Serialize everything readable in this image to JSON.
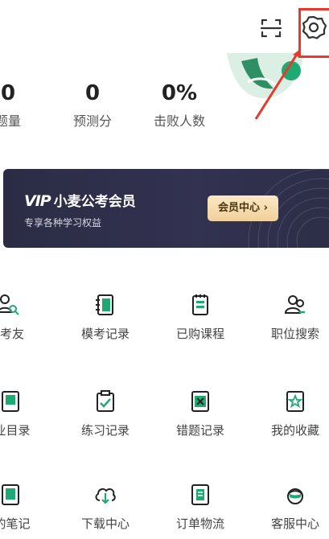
{
  "header": {
    "scan_icon": "scan-icon",
    "settings_icon": "gear-icon",
    "highlight_color": "#e8392b"
  },
  "stats": [
    {
      "value": "0",
      "label": "题量"
    },
    {
      "value": "0",
      "label": "预测分"
    },
    {
      "value": "0%",
      "label": "击败人数"
    }
  ],
  "vip": {
    "logo": "VIP",
    "title": "小麦公考会员",
    "subtitle": "专享各种学习权益",
    "button_label": "会员中心",
    "button_chevron": "›"
  },
  "menu": {
    "row1": [
      {
        "label": "考友",
        "icon": "search-user-icon"
      },
      {
        "label": "模考记录",
        "icon": "exam-record-icon"
      },
      {
        "label": "已购课程",
        "icon": "purchased-course-icon"
      },
      {
        "label": "职位搜索",
        "icon": "job-search-icon"
      }
    ],
    "row2": [
      {
        "label": "业目录",
        "icon": "catalog-icon"
      },
      {
        "label": "练习记录",
        "icon": "practice-record-icon"
      },
      {
        "label": "错题记录",
        "icon": "wrong-question-icon"
      },
      {
        "label": "我的收藏",
        "icon": "favorite-icon"
      }
    ],
    "row3": [
      {
        "label": "的笔记",
        "icon": "notes-icon"
      },
      {
        "label": "下载中心",
        "icon": "download-center-icon"
      },
      {
        "label": "订单物流",
        "icon": "order-logistics-icon"
      },
      {
        "label": "客服中心",
        "icon": "customer-service-icon"
      }
    ]
  },
  "colors": {
    "accent_green": "#1faa73",
    "vip_bg": "#2b2c44",
    "vip_gold": "#f0d09a"
  }
}
